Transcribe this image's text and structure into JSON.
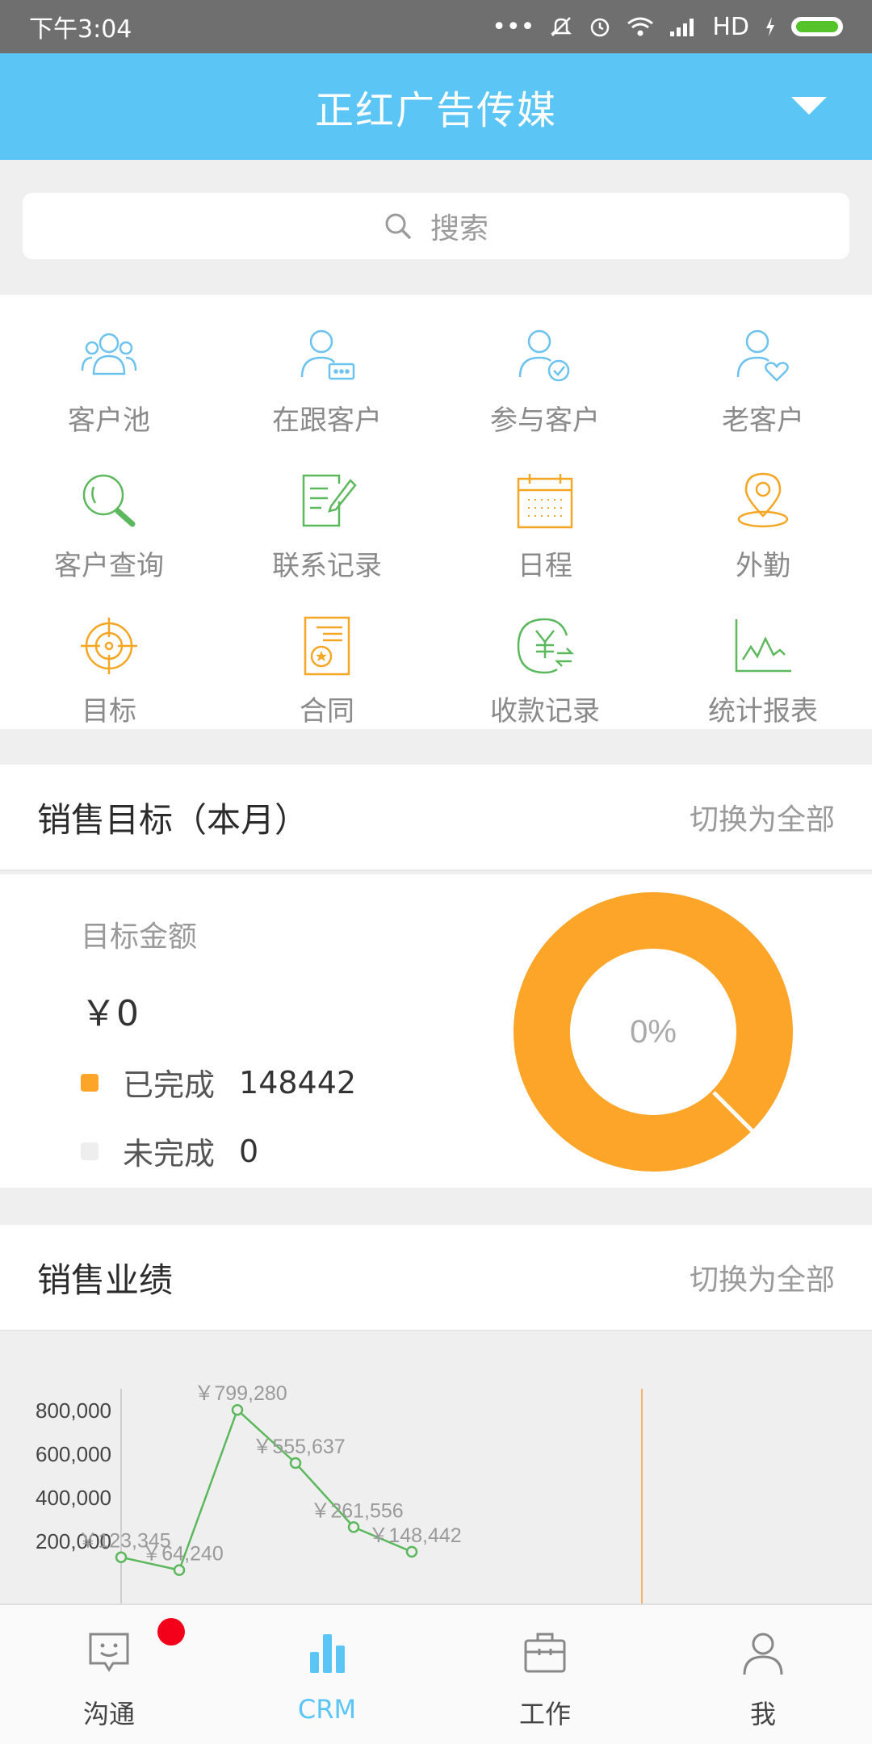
{
  "status": {
    "time": "下午3:04",
    "icons": [
      "dots-icon",
      "mute-icon",
      "alarm-icon",
      "wifi-icon",
      "signal-icon",
      "hd-label",
      "charging-icon",
      "battery-icon"
    ],
    "hd": "HD"
  },
  "header": {
    "title": "正红广告传媒",
    "color": "#5bc6f6"
  },
  "search": {
    "placeholder": "搜索"
  },
  "grid": {
    "items": [
      {
        "label": "客户池",
        "icon": "customer-pool-icon"
      },
      {
        "label": "在跟客户",
        "icon": "following-customer-icon"
      },
      {
        "label": "参与客户",
        "icon": "participating-customer-icon"
      },
      {
        "label": "老客户",
        "icon": "old-customer-icon"
      },
      {
        "label": "客户查询",
        "icon": "customer-search-icon"
      },
      {
        "label": "联系记录",
        "icon": "contact-record-icon"
      },
      {
        "label": "日程",
        "icon": "schedule-icon"
      },
      {
        "label": "外勤",
        "icon": "field-work-icon"
      },
      {
        "label": "目标",
        "icon": "target-icon"
      },
      {
        "label": "合同",
        "icon": "contract-icon"
      },
      {
        "label": "收款记录",
        "icon": "payment-record-icon"
      },
      {
        "label": "统计报表",
        "icon": "statistics-icon"
      }
    ]
  },
  "sales_target": {
    "title": "销售目标（本月）",
    "switch_label": "切换为全部",
    "amount_label": "目标金额",
    "amount": "￥0",
    "completed_label": "已完成",
    "completed_value": "148442",
    "incomplete_label": "未完成",
    "incomplete_value": "0",
    "percent": "0%",
    "colors": {
      "completed": "#fca528",
      "incomplete": "#eeeeee"
    }
  },
  "sales_performance": {
    "title": "销售业绩",
    "switch_label": "切换为全部"
  },
  "chart_data": {
    "type": "line",
    "y_ticks": [
      "800,000",
      "600,000",
      "400,000",
      "200,000"
    ],
    "ylim": [
      0,
      800000
    ],
    "series": [
      {
        "values": [
          123345,
          64240,
          799280,
          555637,
          261556,
          148442
        ],
        "labels": [
          "￥123,345",
          "￥64,240",
          "￥799,280",
          "￥555,637",
          "￥261,556",
          "￥148,442"
        ]
      }
    ],
    "line_color": "#5cb85c"
  },
  "tabbar": {
    "tabs": [
      {
        "label": "沟通",
        "icon": "chat-icon"
      },
      {
        "label": "CRM",
        "icon": "crm-chart-icon"
      },
      {
        "label": "工作",
        "icon": "briefcase-icon"
      },
      {
        "label": "我",
        "icon": "person-icon"
      }
    ],
    "active": "CRM"
  }
}
